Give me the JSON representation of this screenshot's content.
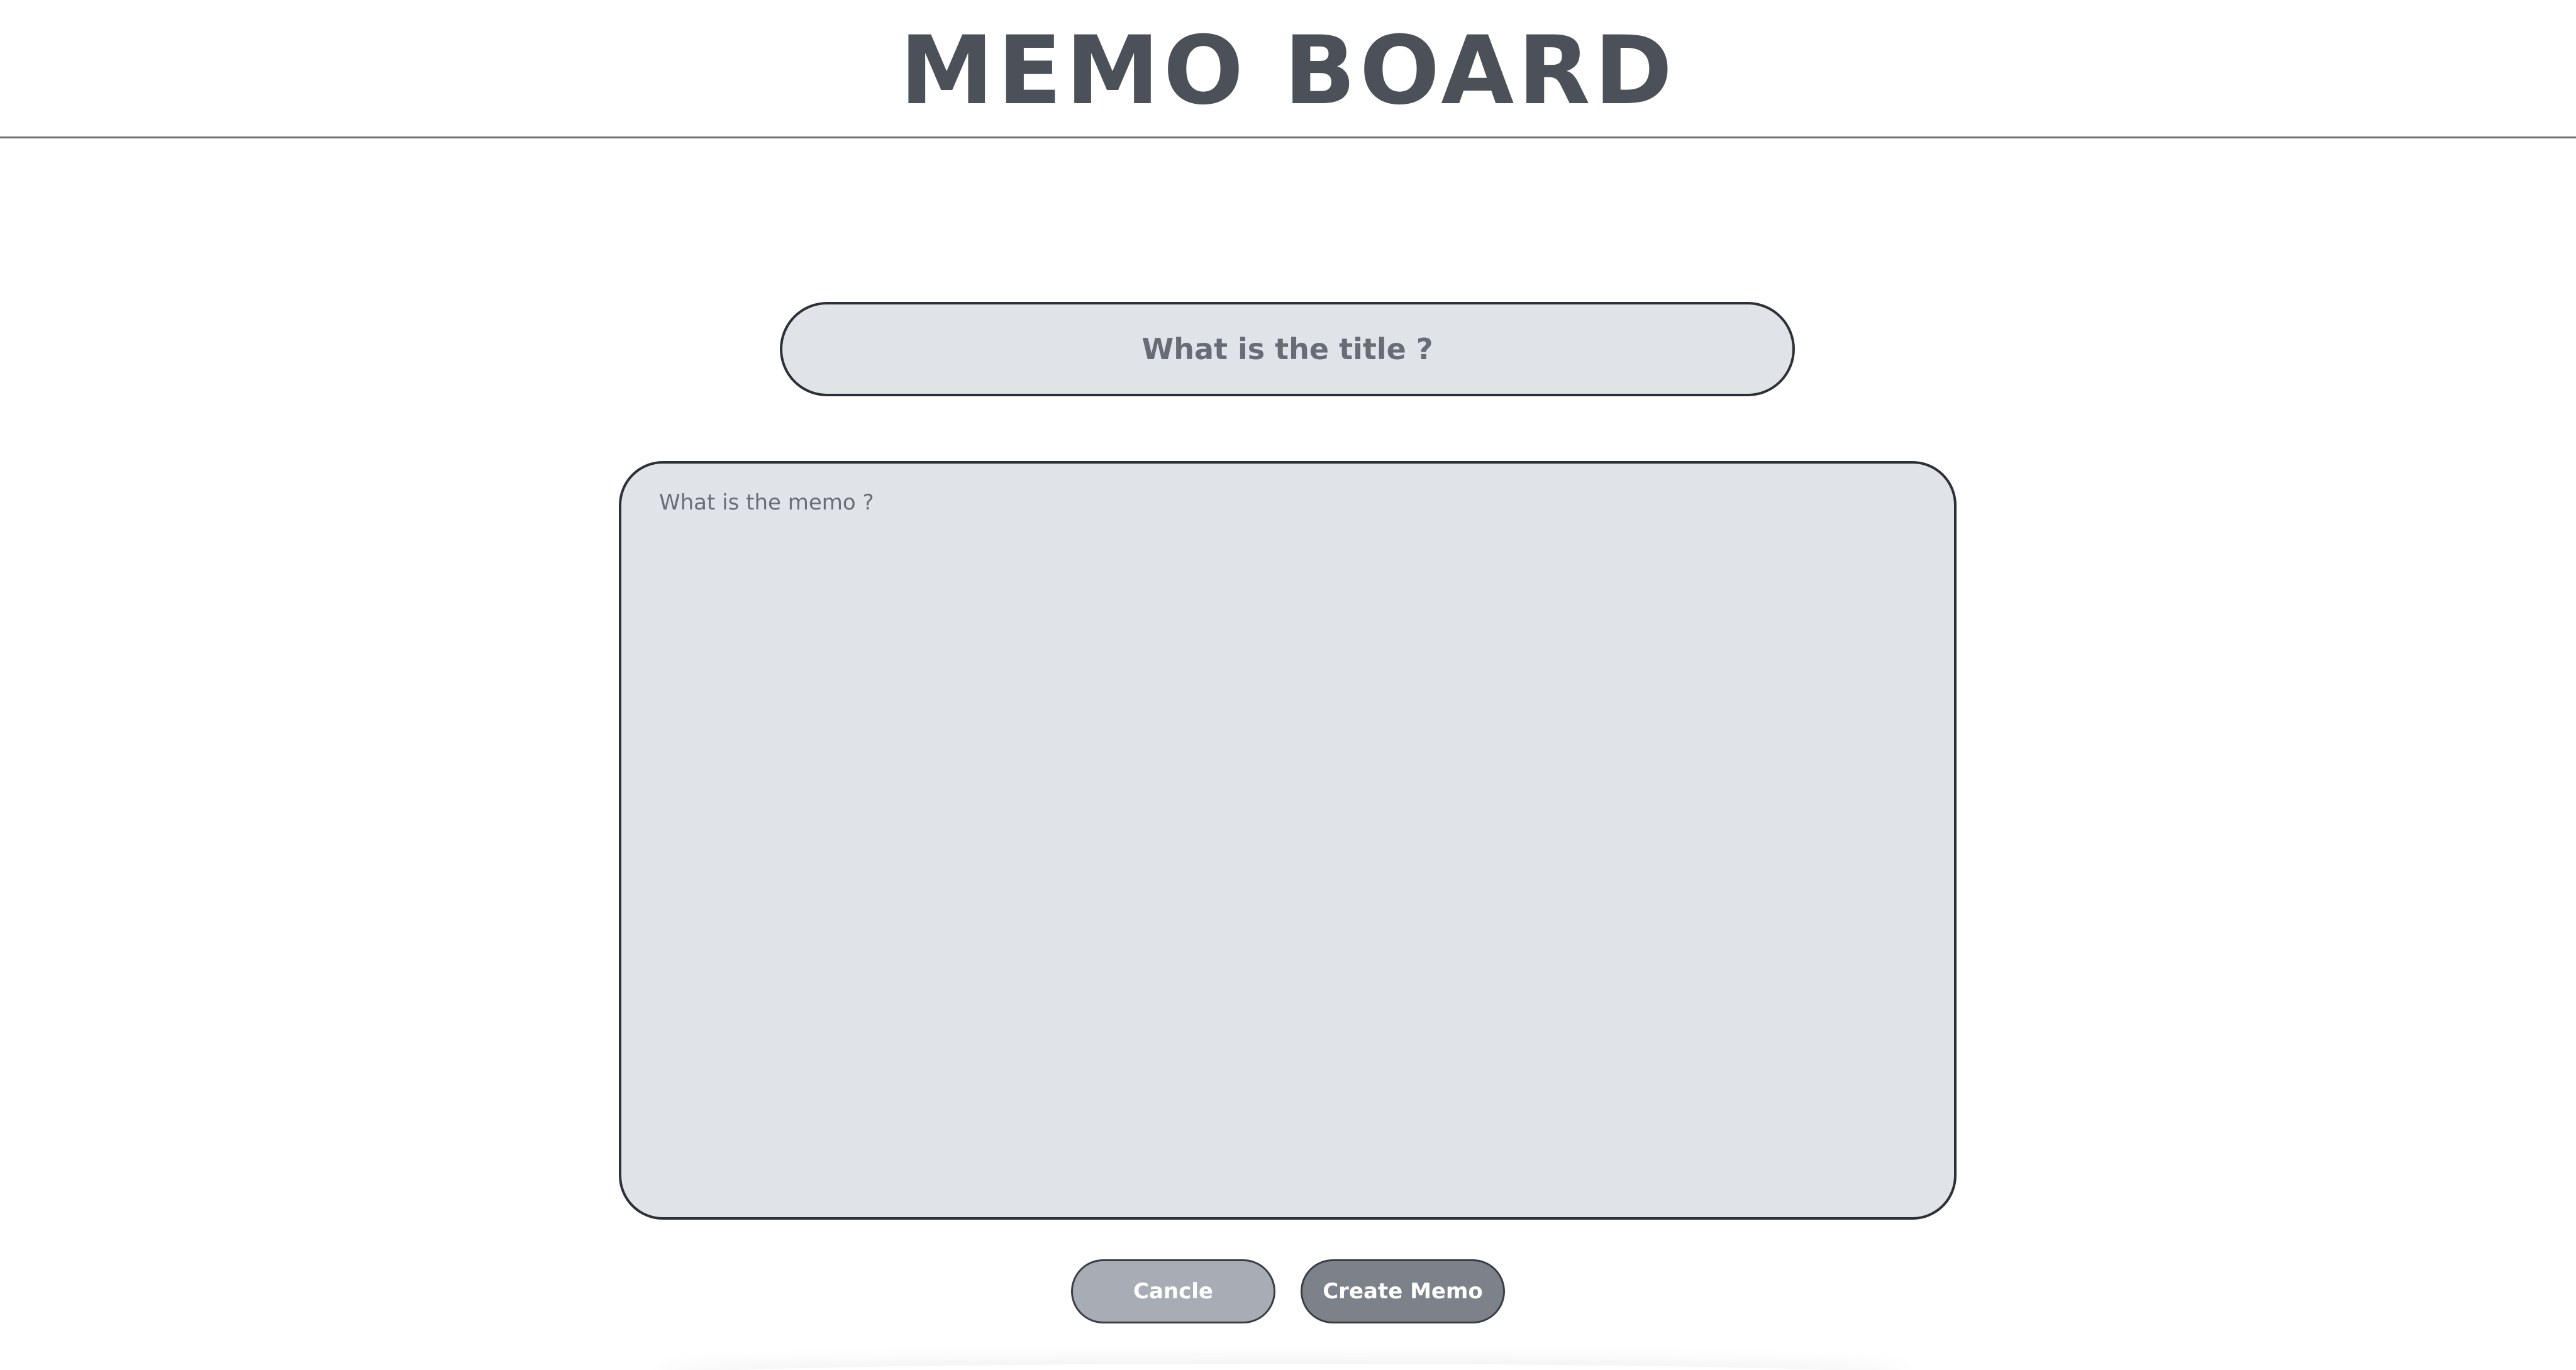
{
  "header": {
    "title": "MEMO BOARD"
  },
  "form": {
    "title_input": {
      "value": "",
      "placeholder": "What is the title ?"
    },
    "memo_input": {
      "value": "",
      "placeholder": "What is the memo ?"
    },
    "cancel_label": "Cancle",
    "create_label": "Create Memo"
  },
  "colors": {
    "text": "#4b5059",
    "field_background": "#e0e3e7",
    "field_border": "#2d3038",
    "cancel_button": "#a8acb4",
    "create_button": "#7d818a"
  }
}
